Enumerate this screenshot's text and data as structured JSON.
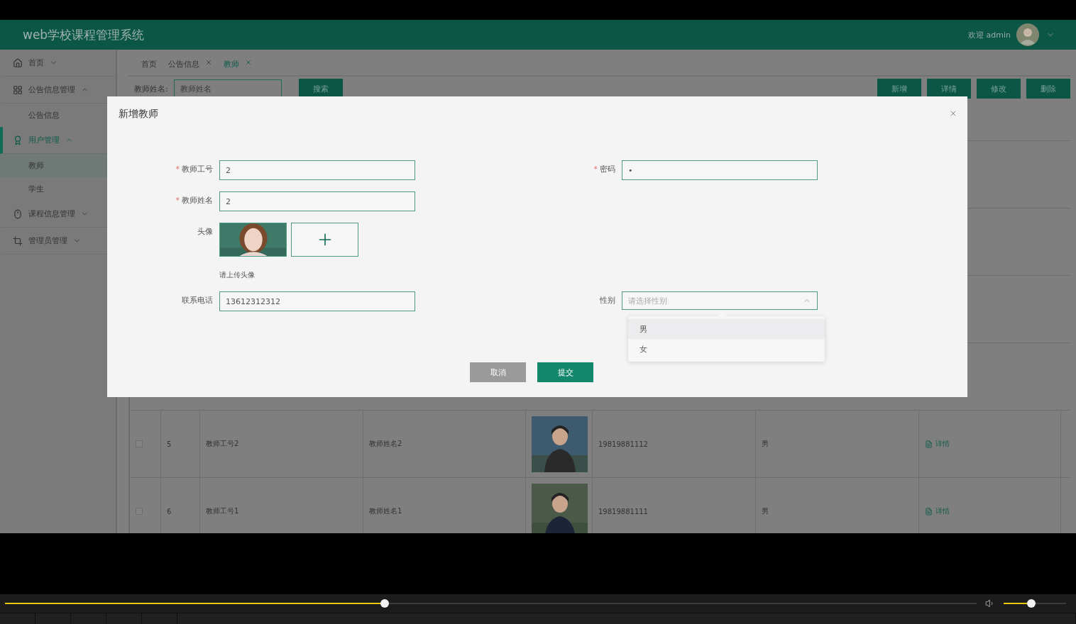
{
  "header": {
    "title": "web学校课程管理系统",
    "welcome": "欢迎 admin"
  },
  "sidebar": {
    "items": [
      {
        "label": "首页",
        "expanded": false,
        "selected": false
      },
      {
        "label": "公告信息管理",
        "expanded": true,
        "selected": false,
        "children": [
          {
            "label": "公告信息",
            "selected": false
          }
        ]
      },
      {
        "label": "用户管理",
        "expanded": true,
        "selected": true,
        "children": [
          {
            "label": "教师",
            "selected": true
          },
          {
            "label": "学生",
            "selected": false
          }
        ]
      },
      {
        "label": "课程信息管理",
        "expanded": false,
        "selected": false
      },
      {
        "label": "管理员管理",
        "expanded": false,
        "selected": false
      }
    ]
  },
  "tabs": [
    {
      "label": "首页",
      "closable": false,
      "selected": false
    },
    {
      "label": "公告信息",
      "closable": true,
      "selected": false
    },
    {
      "label": "教师",
      "closable": true,
      "selected": true
    }
  ],
  "search": {
    "label": "教师姓名:",
    "placeholder": "教师姓名",
    "button": "搜索"
  },
  "actions": [
    "新增",
    "详情",
    "修改",
    "删除"
  ],
  "table": {
    "rows": [
      {
        "checked": false,
        "index": "5",
        "teacher_id": "教师工号2",
        "teacher_name": "教师姓名2",
        "phone": "19819881112",
        "gender": "男",
        "action": "详情"
      },
      {
        "checked": false,
        "index": "6",
        "teacher_id": "教师工号1",
        "teacher_name": "教师姓名1",
        "phone": "19819881111",
        "gender": "男",
        "action": "详情"
      }
    ]
  },
  "dialog": {
    "title": "新增教师",
    "rows": [
      [
        {
          "kind": "text",
          "required_mark": "*",
          "label": "教师工号",
          "value": "2"
        },
        {
          "kind": "text",
          "required_mark": "*",
          "label": "密码",
          "value": "•"
        }
      ],
      [
        {
          "kind": "text",
          "required_mark": "*",
          "label": "教师姓名",
          "value": "2"
        }
      ],
      [
        {
          "kind": "upload",
          "label": "头像",
          "hint": "请上传头像"
        }
      ],
      [
        {
          "kind": "text",
          "label": "联系电话",
          "value": "13612312312"
        },
        {
          "kind": "select",
          "label": "性别",
          "placeholder": "请选择性别",
          "expanded": true,
          "options": [
            {
              "label": "男",
              "highlighted": true
            },
            {
              "label": "女",
              "highlighted": false
            }
          ]
        }
      ]
    ],
    "buttons": [
      {
        "label": "取消",
        "kind": "cancel"
      },
      {
        "label": "提交",
        "kind": "submit"
      }
    ]
  },
  "player": {
    "progress": {
      "level": 0.39
    },
    "volume": {
      "level": 0.44
    }
  }
}
